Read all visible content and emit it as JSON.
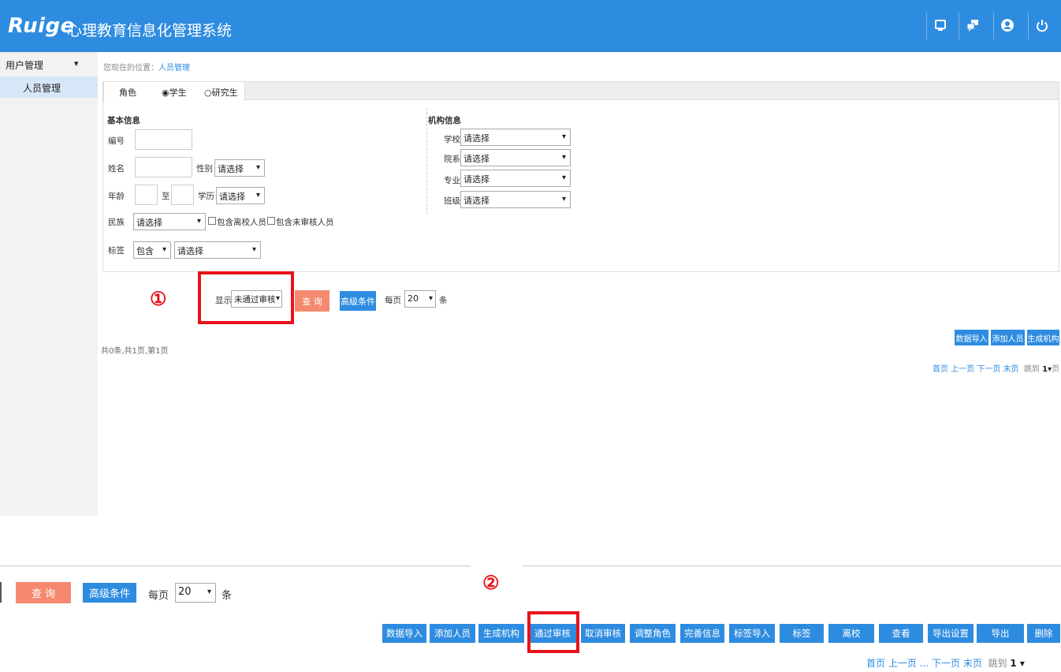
{
  "header": {
    "logo": "Ruige",
    "title": "心理教育信息化管理系统"
  },
  "sidebar": {
    "group_label": "用户管理",
    "items": [
      {
        "label": "人员管理"
      }
    ]
  },
  "breadcrumb": {
    "prefix": "您现在的位置：",
    "current": "人员管理"
  },
  "role": {
    "label": "角色",
    "options": [
      "学生",
      "研究生"
    ],
    "selected": "学生"
  },
  "basic_info": {
    "heading": "基本信息",
    "id_label": "编号",
    "name_label": "姓名",
    "gender_label": "性别",
    "gender_value": "请选择",
    "age_label": "年龄",
    "age_to": "至",
    "education_label": "学历",
    "education_value": "请选择",
    "ethnicity_label": "民族",
    "ethnicity_value": "请选择",
    "include_left_label": "包含离校人员",
    "include_unreviewed_label": "包含未审核人员",
    "tag_label": "标签",
    "tag_mode_value": "包含",
    "tag_value": "请选择"
  },
  "org_info": {
    "heading": "机构信息",
    "school_label": "学校",
    "school_value": "请选择",
    "dept_label": "院系",
    "dept_value": "请选择",
    "major_label": "专业",
    "major_value": "请选择",
    "class_label": "班级",
    "class_value": "请选择"
  },
  "query": {
    "marker1": "①",
    "show_label": "显示",
    "show_value": "未通过审核",
    "search_label": "查 询",
    "advanced_label": "高级条件",
    "per_page_label": "每页",
    "per_page_value": "20",
    "unit_label": "条"
  },
  "actions_top": [
    "数据导入",
    "添加人员",
    "生成机构"
  ],
  "summary": "共0条,共1页,第1页",
  "pager_top": {
    "first": "首页",
    "prev": "上一页",
    "next": "下一页",
    "last": "末页",
    "jump": "跳到",
    "page": "1",
    "page_unit": "页"
  },
  "zoom": {
    "marker2": "②",
    "search_label": "查 询",
    "advanced_label": "高级条件",
    "per_page_label": "每页",
    "per_page_value": "20",
    "unit_label": "条",
    "actions": [
      "数据导入",
      "添加人员",
      "生成机构",
      "通过审核",
      "取消审核",
      "调整角色",
      "完善信息",
      "标签导入",
      "标签",
      "离校",
      "查看",
      "导出设置",
      "导出",
      "删除"
    ],
    "pager": {
      "first": "首页",
      "prev": "上一页",
      "ellipsis": "...",
      "next": "下一页",
      "last": "末页",
      "jump": "跳到",
      "page": "1"
    }
  },
  "colors": {
    "primary": "#2e8ce0",
    "search_button": "#f5896f",
    "highlight": "#e8131b",
    "sidebar_active": "#d6e7f7"
  }
}
